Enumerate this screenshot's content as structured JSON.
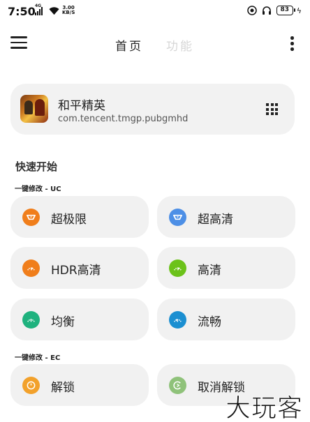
{
  "status_bar": {
    "time": "7:50",
    "network_label": "4G",
    "speed_value": "3.00",
    "speed_unit": "KB/S",
    "battery": "83"
  },
  "app_bar": {
    "tabs": [
      {
        "label": "首页",
        "active": true
      },
      {
        "label": "功能",
        "active": false
      }
    ]
  },
  "app_card": {
    "name": "和平精英",
    "package": "com.tencent.tmgp.pubgmhd"
  },
  "quick_start": {
    "title": "快速开始",
    "groups": [
      {
        "label": "一键修改 - UC",
        "options": [
          {
            "label": "超极限",
            "icon": "extreme-icon",
            "color": "#f07e1b"
          },
          {
            "label": "超高清",
            "icon": "ultra-hd-icon",
            "color": "#4d8fe6"
          },
          {
            "label": "HDR高清",
            "icon": "hdr-gauge-icon",
            "color": "#f07e1b"
          },
          {
            "label": "高清",
            "icon": "hd-gauge-icon",
            "color": "#6cc21a"
          },
          {
            "label": "均衡",
            "icon": "balanced-gauge-icon",
            "color": "#1fb27e"
          },
          {
            "label": "流畅",
            "icon": "smooth-gauge-icon",
            "color": "#1b8fd1"
          }
        ]
      },
      {
        "label": "一键修改 - EC",
        "options": [
          {
            "label": "解锁",
            "icon": "unlock-icon",
            "color": "#f2a12b"
          },
          {
            "label": "取消解锁",
            "icon": "cancel-unlock-icon",
            "color": "#8fc27a"
          }
        ]
      }
    ]
  },
  "watermark": "大玩客"
}
